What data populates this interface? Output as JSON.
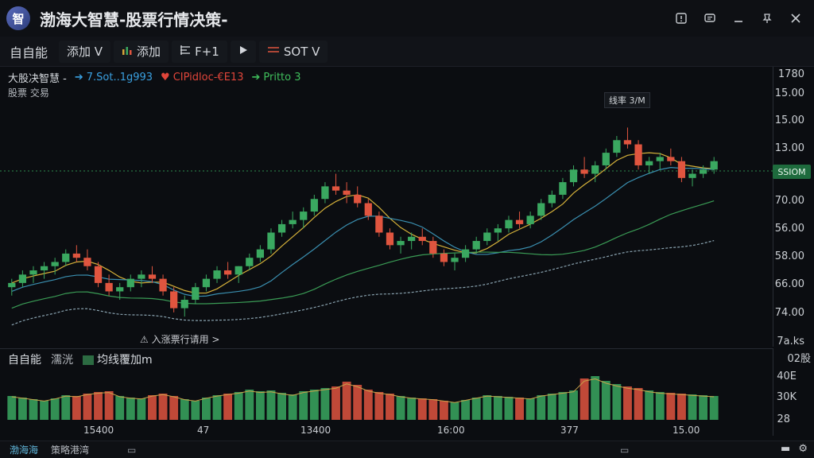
{
  "app": {
    "title": "渤海大智慧-股票行情决策-",
    "logo_text": "智"
  },
  "titlebar": {
    "icons": [
      "alert-icon",
      "message-icon",
      "minimize-icon",
      "pin-icon",
      "close-icon"
    ]
  },
  "toolbar": {
    "items": [
      {
        "label": "自自能",
        "icon": ""
      },
      {
        "label": "添加 V",
        "icon": ""
      },
      {
        "label": "添加",
        "icon": "bar-chart-icon"
      },
      {
        "label": "F+1",
        "icon": "drawing-icon"
      },
      {
        "label": "",
        "icon": "play-icon"
      },
      {
        "label": "SOT V",
        "icon": "indicator-icon"
      }
    ]
  },
  "legend": {
    "title": "大股决智慧 -",
    "series": [
      {
        "label": "7.Sot..1g993",
        "color": "#3aa0e0"
      },
      {
        "label": "CIPidloc-€E13",
        "color": "#e0453a"
      },
      {
        "label": "Pritto 3",
        "color": "#3fbf5c"
      }
    ],
    "sub": "股票 交易"
  },
  "annotations": {
    "peak": "线率 3/M",
    "hint": "⚠ 入涨票行请用 >"
  },
  "price_axis": {
    "top_label": "1780",
    "labels": [
      "15.00",
      "15.00",
      "13.00",
      "70.00",
      "56.00",
      "58.00",
      "66.00",
      "74.00",
      "7a.ks"
    ],
    "current_price": "SSIOM"
  },
  "volume_panel": {
    "tabs": [
      "自自能",
      "濡洸",
      "均线覆加m"
    ],
    "axis_labels": [
      "02股",
      "40E",
      "30K",
      "28"
    ]
  },
  "x_axis": {
    "labels": [
      "15400",
      "47",
      "13400",
      "16:00",
      "377",
      "15.00"
    ]
  },
  "statusbar": {
    "left": "渤海海",
    "second": "策略港湾",
    "right_icons": [
      "save-icon",
      "settings-icon"
    ]
  },
  "colors": {
    "up": "#3aa860",
    "down": "#e0553f",
    "ma_yellow": "#d6b23a",
    "ma_blue": "#3a8fb0",
    "ma_green": "#3a9b55",
    "ma_gray": "#8aa3b0"
  },
  "chart_data": {
    "type": "candlestick",
    "candles": [
      [
        52,
        54,
        50,
        53
      ],
      [
        53,
        56,
        52,
        55
      ],
      [
        55,
        57,
        53,
        56
      ],
      [
        56,
        58,
        54,
        57
      ],
      [
        57,
        59,
        55,
        58
      ],
      [
        58,
        61,
        57,
        60
      ],
      [
        60,
        62,
        58,
        59
      ],
      [
        59,
        61,
        56,
        57
      ],
      [
        57,
        58,
        52,
        53
      ],
      [
        53,
        55,
        50,
        51
      ],
      [
        51,
        53,
        49,
        52
      ],
      [
        52,
        55,
        51,
        54
      ],
      [
        54,
        56,
        52,
        55
      ],
      [
        55,
        57,
        53,
        54
      ],
      [
        54,
        55,
        50,
        51
      ],
      [
        51,
        52,
        46,
        47
      ],
      [
        47,
        50,
        45,
        49
      ],
      [
        49,
        53,
        48,
        52
      ],
      [
        52,
        55,
        51,
        54
      ],
      [
        54,
        57,
        53,
        56
      ],
      [
        56,
        58,
        54,
        55
      ],
      [
        55,
        57,
        53,
        57
      ],
      [
        57,
        60,
        56,
        59
      ],
      [
        59,
        62,
        58,
        61
      ],
      [
        61,
        66,
        60,
        65
      ],
      [
        65,
        68,
        64,
        67
      ],
      [
        67,
        70,
        66,
        68
      ],
      [
        68,
        71,
        66,
        70
      ],
      [
        70,
        74,
        69,
        73
      ],
      [
        73,
        77,
        72,
        76
      ],
      [
        76,
        79,
        74,
        75
      ],
      [
        75,
        77,
        72,
        74
      ],
      [
        74,
        76,
        71,
        72
      ],
      [
        72,
        73,
        68,
        69
      ],
      [
        69,
        70,
        64,
        65
      ],
      [
        65,
        66,
        61,
        62
      ],
      [
        62,
        64,
        60,
        63
      ],
      [
        63,
        65,
        61,
        64
      ],
      [
        64,
        66,
        62,
        63
      ],
      [
        63,
        64,
        59,
        60
      ],
      [
        60,
        61,
        57,
        58
      ],
      [
        58,
        60,
        56,
        59
      ],
      [
        59,
        62,
        58,
        61
      ],
      [
        61,
        64,
        60,
        63
      ],
      [
        63,
        66,
        62,
        65
      ],
      [
        65,
        67,
        63,
        66
      ],
      [
        66,
        69,
        65,
        68
      ],
      [
        68,
        70,
        66,
        67
      ],
      [
        67,
        70,
        66,
        69
      ],
      [
        69,
        73,
        68,
        72
      ],
      [
        72,
        75,
        71,
        74
      ],
      [
        74,
        78,
        73,
        77
      ],
      [
        77,
        81,
        76,
        80
      ],
      [
        80,
        83,
        78,
        79
      ],
      [
        79,
        82,
        77,
        81
      ],
      [
        81,
        85,
        80,
        84
      ],
      [
        84,
        88,
        83,
        87
      ],
      [
        87,
        90,
        85,
        86
      ],
      [
        86,
        87,
        80,
        81
      ],
      [
        81,
        83,
        79,
        82
      ],
      [
        82,
        84,
        80,
        83
      ],
      [
        83,
        85,
        81,
        82
      ],
      [
        82,
        83,
        77,
        78
      ],
      [
        78,
        80,
        76,
        79
      ],
      [
        79,
        81,
        78,
        80
      ],
      [
        80,
        83,
        79,
        82
      ]
    ],
    "ma": [
      {
        "name": "MA-yellow",
        "values": []
      },
      {
        "name": "MA-blue",
        "values": []
      }
    ],
    "volume": [
      30,
      28,
      26,
      24,
      27,
      31,
      30,
      33,
      35,
      36,
      30,
      28,
      27,
      31,
      33,
      30,
      26,
      24,
      28,
      31,
      33,
      35,
      38,
      36,
      37,
      34,
      32,
      36,
      38,
      40,
      42,
      48,
      44,
      38,
      35,
      33,
      30,
      28,
      27,
      26,
      24,
      22,
      25,
      28,
      31,
      30,
      29,
      28,
      27,
      31,
      33,
      35,
      37,
      52,
      55,
      49,
      45,
      42,
      40,
      37,
      35,
      34,
      33,
      32,
      31,
      30
    ]
  }
}
